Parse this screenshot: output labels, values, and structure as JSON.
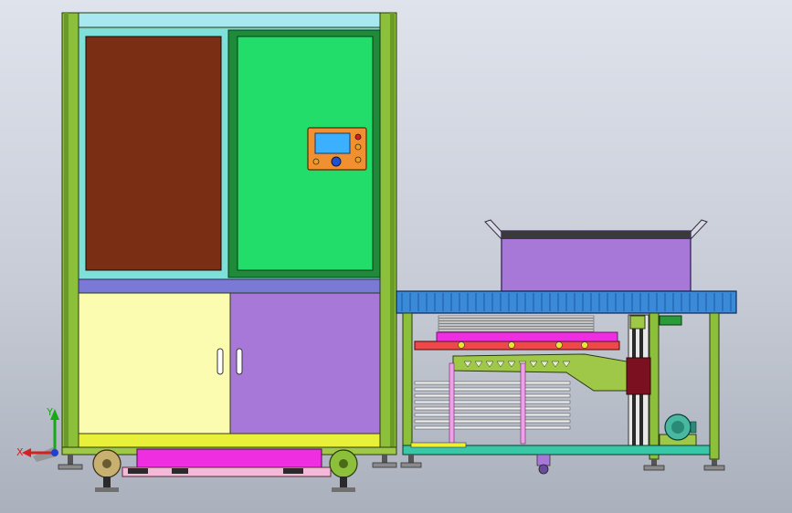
{
  "viewport": {
    "background_top": "#dfe3ec",
    "background_bottom": "#aab0bc"
  },
  "axis_triad": {
    "x_label": "X",
    "y_label": "Y",
    "x_color": "#d32020",
    "y_color": "#18a818",
    "z_color": "#2040d0"
  },
  "cabinet": {
    "frame_color": "#8cbf3a",
    "top_band_color": "#a8e8f0",
    "window_frame_color": "#7ee0d8",
    "brown_panel_color": "#7a2e14",
    "green_panel_color": "#22dd6a",
    "divider_color": "#7a7ad6",
    "left_door_color": "#fcfcb0",
    "right_door_color": "#a878d8",
    "base_rail_color": "#e8f03a",
    "magenta_tray_color": "#ee2ee0",
    "pink_tray_color": "#f4b8d8",
    "control_panel": {
      "housing_color": "#f09030",
      "screen_color": "#3ab0ff",
      "knob_color": "#2050d0",
      "indicators": [
        "#d02020",
        "#f0a020",
        "#f0a020"
      ]
    }
  },
  "conveyor": {
    "table_color": "#3a8ad8",
    "bin_color": "#a878d8",
    "leg_color": "#8cbf3a",
    "arm_color": "#a0c848",
    "red_rail_color": "#f04848",
    "motor_color": "#48b8a0",
    "stack_plate_count": 9,
    "lower_plate_count": 8
  }
}
